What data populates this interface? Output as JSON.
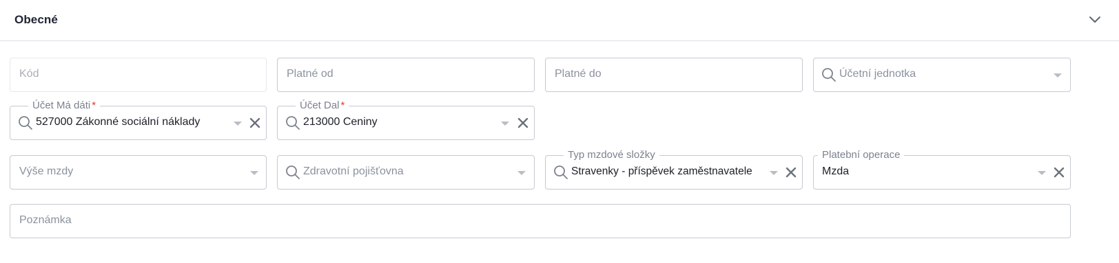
{
  "section": {
    "title": "Obecné"
  },
  "fields": {
    "kod": {
      "placeholder": "Kód"
    },
    "platne_od": {
      "placeholder": "Platné od"
    },
    "platne_do": {
      "placeholder": "Platné do"
    },
    "ucetni_jednotka": {
      "placeholder": "Účetní jednotka"
    },
    "ucet_ma_dati": {
      "label": "Účet Má dáti",
      "required_mark": "*",
      "value": "527000 Zákonné sociální náklady"
    },
    "ucet_dal": {
      "label": "Účet Dal",
      "required_mark": "*",
      "value": "213000 Ceniny"
    },
    "vyse_mzdy": {
      "placeholder": "Výše mzdy"
    },
    "zdravotni_pojistovna": {
      "placeholder": "Zdravotní pojišťovna"
    },
    "typ_mzdove_slozky": {
      "label": "Typ mzdové složky",
      "value": "Stravenky - příspěvek zaměstnavatele"
    },
    "platebni_operace": {
      "label": "Platební operace",
      "value": "Mzda"
    },
    "poznamka": {
      "placeholder": "Poznámka"
    }
  },
  "icons": {
    "collapse": "chevron-down-icon",
    "search": "search-icon",
    "clear": "close-icon",
    "dropdown": "caret-down-icon"
  },
  "colors": {
    "border": "#c5c9d0",
    "required": "#e53935",
    "placeholder": "#8b929e",
    "text": "#1b1f27"
  }
}
